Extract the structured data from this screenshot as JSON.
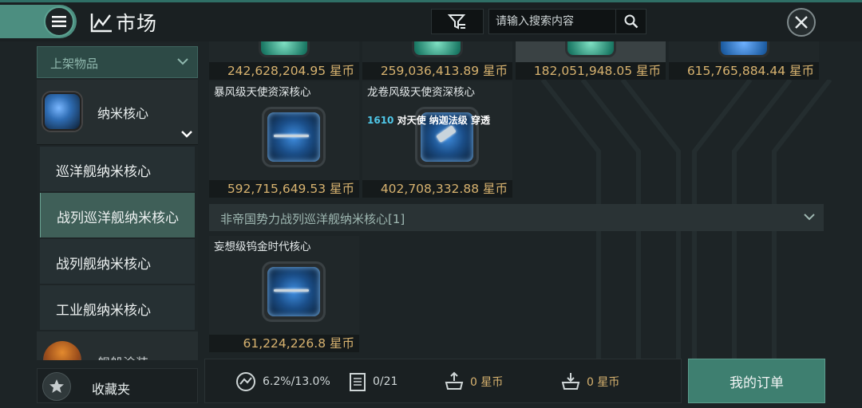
{
  "header": {
    "title": "市场",
    "search_placeholder": "请输入搜索内容"
  },
  "sidebar": {
    "dropdown_label": "上架物品",
    "category": "纳米核心",
    "subcategories": [
      "巡洋舰纳米核心",
      "战列巡洋舰纳米核心",
      "战列舰纳米核心",
      "工业舰纳米核心"
    ],
    "active_index": 1,
    "next_category": "舰船涂装",
    "favorites_label": "收藏夹"
  },
  "top_prices": [
    "242,628,204.95 星币",
    "259,036,413.89 星币",
    "182,051,948.05 星币",
    "615,765,884.44 星币"
  ],
  "cards": [
    {
      "name": "暴风级天使资深核心",
      "price": "592,715,649.53 星币"
    },
    {
      "name": "龙卷风级天使资深核心",
      "price": "402,708,332.88 星币"
    },
    {
      "name": "妄想级钨金时代核心",
      "price": "61,224,226.8 星币"
    }
  ],
  "tooltip": {
    "level": "1610",
    "text": "对天使 纳迦法级 穿透"
  },
  "section_label": "非帝国势力战列巡洋舰纳米核心[1]",
  "bottom": {
    "tax": "6.2%/13.0%",
    "orders": "0/21",
    "sell_amount": "0 星币",
    "buy_amount": "0 星币",
    "my_orders_label": "我的订单"
  },
  "colors": {
    "accent": "#4c8e80",
    "price": "#d7b26f"
  }
}
